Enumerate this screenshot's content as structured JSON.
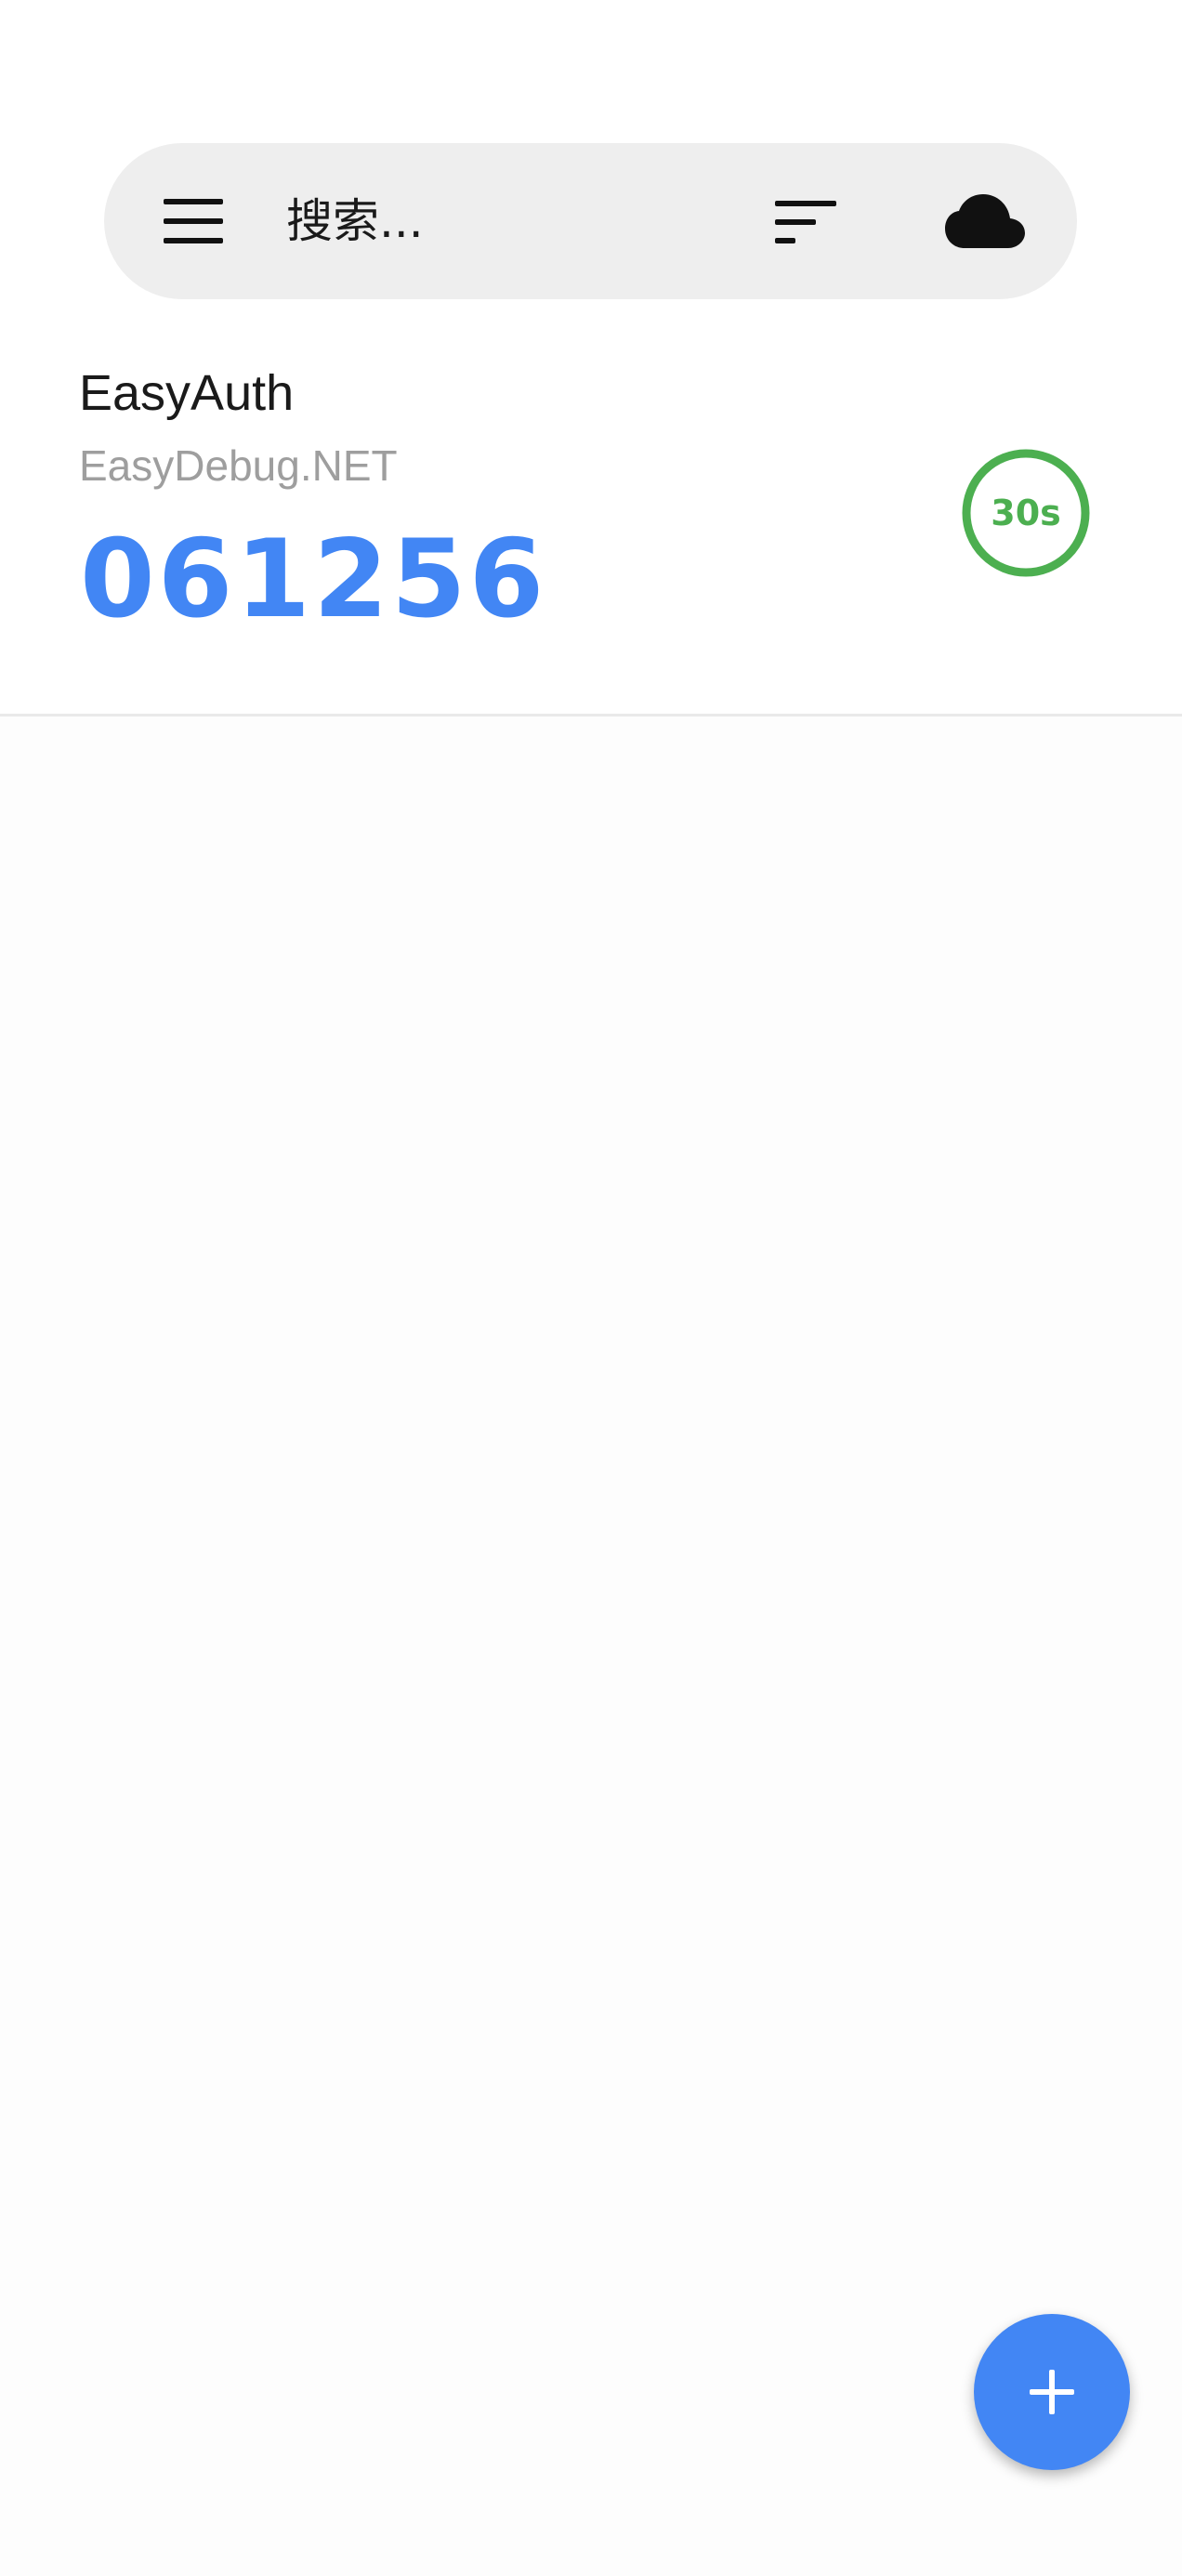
{
  "search_bar": {
    "placeholder": "搜索...",
    "icons": {
      "menu": "menu-icon",
      "sort": "sort-icon",
      "sync": "cloud-icon"
    }
  },
  "accounts": [
    {
      "name": "EasyAuth",
      "issuer": "EasyDebug.NET",
      "code": "061256",
      "timer_label": "30s",
      "timer_remaining_fraction": 1.0
    }
  ],
  "fab": {
    "icon": "plus-icon"
  },
  "colors": {
    "accent": "#4286f4",
    "timer": "#4caf50",
    "issuer_text": "#9e9e9e",
    "search_bg": "#eeeeee"
  }
}
